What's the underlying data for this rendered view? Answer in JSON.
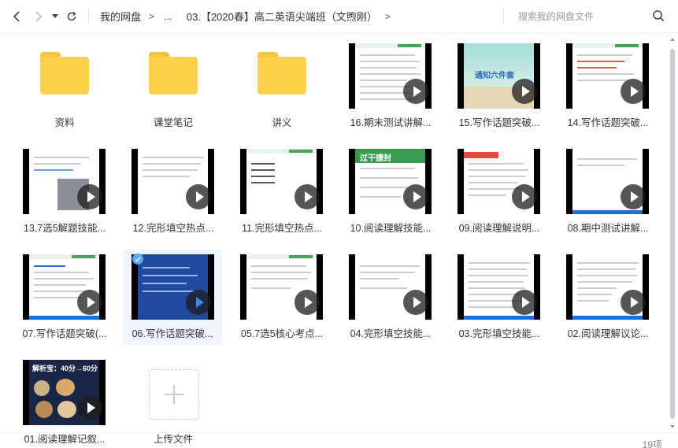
{
  "toolbar": {
    "back_icon": "chevron-left-icon",
    "forward_icon": "chevron-right-icon",
    "history_icon": "caret-down-icon",
    "refresh_icon": "refresh-icon"
  },
  "breadcrumb": {
    "root": "我的网盘",
    "sep": ">",
    "ellipsis": "...",
    "current": "03.【2020春】高二英语尖端班（文煦刚）",
    "trail_sep": ">"
  },
  "search": {
    "placeholder": "搜索我的网盘文件",
    "icon": "search-icon"
  },
  "items": [
    {
      "name": "资料",
      "type": "folder"
    },
    {
      "name": "课堂笔记",
      "type": "folder"
    },
    {
      "name": "讲义",
      "type": "folder"
    },
    {
      "name": "16.期末测试讲解...",
      "type": "video"
    },
    {
      "name": "15.写作话题突破...",
      "type": "video"
    },
    {
      "name": "14.写作话题突破...",
      "type": "video"
    },
    {
      "name": "13.7选5解题技能...",
      "type": "video"
    },
    {
      "name": "12.完形填空热点...",
      "type": "video"
    },
    {
      "name": "11.完形填空热点...",
      "type": "video"
    },
    {
      "name": "10.阅读理解技能...",
      "type": "video"
    },
    {
      "name": "09.阅读理解说明...",
      "type": "video"
    },
    {
      "name": "08.期中测试讲解...",
      "type": "video"
    },
    {
      "name": "07.写作话题突破(...",
      "type": "video"
    },
    {
      "name": "06.写作话题突破...",
      "type": "video",
      "selected": true
    },
    {
      "name": "05.7选5核心考点...",
      "type": "video"
    },
    {
      "name": "04.完形填空技能...",
      "type": "video"
    },
    {
      "name": "03.完形填空技能...",
      "type": "video"
    },
    {
      "name": "02.阅读理解议论...",
      "type": "video"
    },
    {
      "name": "01.阅读理解记叙...",
      "type": "video"
    },
    {
      "name": "上传文件",
      "type": "add"
    }
  ],
  "thumb_text": {
    "t15": "通知六件套",
    "t10": "过干捷封",
    "t01": "解析宝：40分→60分"
  },
  "footer": {
    "count": "19项"
  },
  "colors": {
    "folder": "#fbd14b",
    "selected_bg": "#eef5fe",
    "accent": "#2f8df5"
  }
}
